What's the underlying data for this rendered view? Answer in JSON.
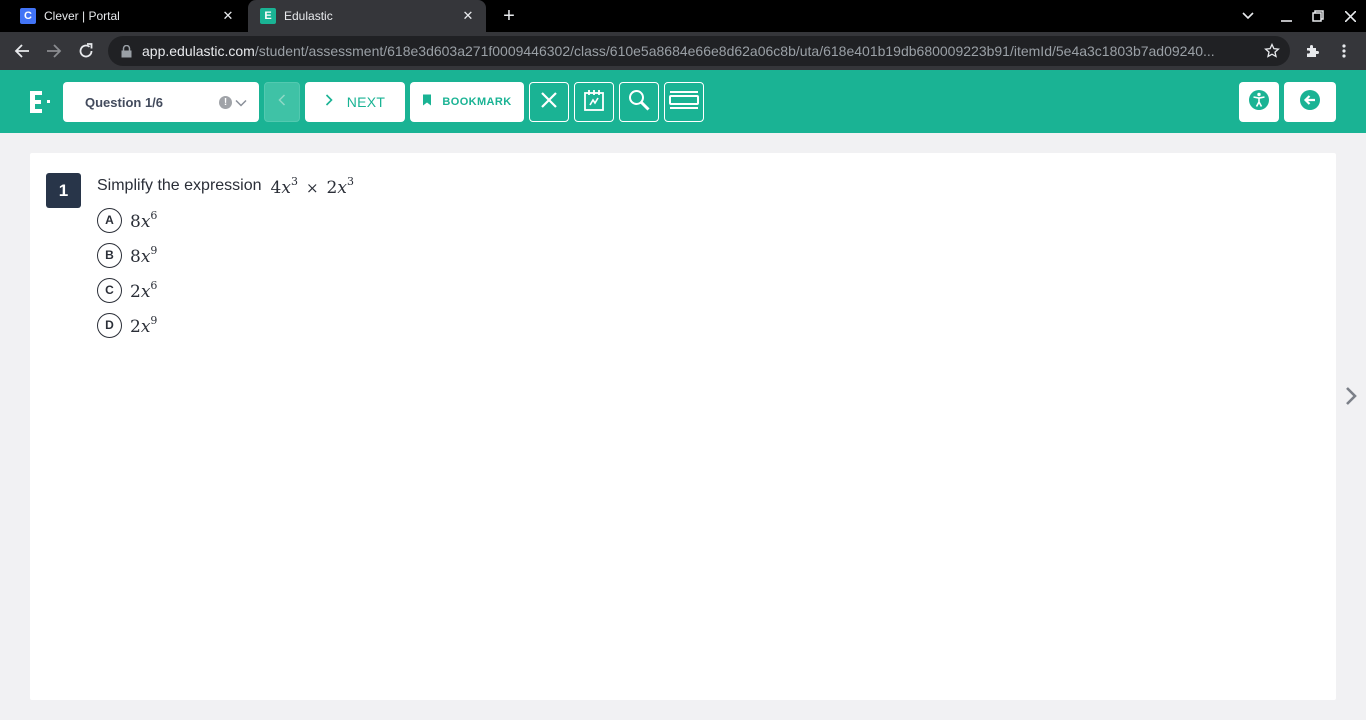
{
  "browser": {
    "tabs": [
      {
        "title": "Clever | Portal",
        "favicon": "C",
        "active": false
      },
      {
        "title": "Edulastic",
        "favicon": "E",
        "active": true
      }
    ],
    "url_host": "app.edulastic.com",
    "url_path": "/student/assessment/618e3d603a271f0009446302/class/610e5a8684e66e8d62a06c8b/uta/618e401b19db680009223b91/itemId/5e4a3c1803b7ad09240..."
  },
  "header": {
    "question_selector": "Question 1/6",
    "next_label": "NEXT",
    "bookmark_label": "BOOKMARK",
    "brand_color": "#1ab394"
  },
  "question": {
    "number": "1",
    "prompt": "Simplify the expression",
    "expression": {
      "a_coef": "4",
      "a_var": "x",
      "a_exp": "3",
      "op": "×",
      "b_coef": "2",
      "b_var": "x",
      "b_exp": "3"
    },
    "options": [
      {
        "letter": "A",
        "coef": "8",
        "var": "x",
        "exp": "6"
      },
      {
        "letter": "B",
        "coef": "8",
        "var": "x",
        "exp": "9"
      },
      {
        "letter": "C",
        "coef": "2",
        "var": "x",
        "exp": "6"
      },
      {
        "letter": "D",
        "coef": "2",
        "var": "x",
        "exp": "9"
      }
    ]
  }
}
